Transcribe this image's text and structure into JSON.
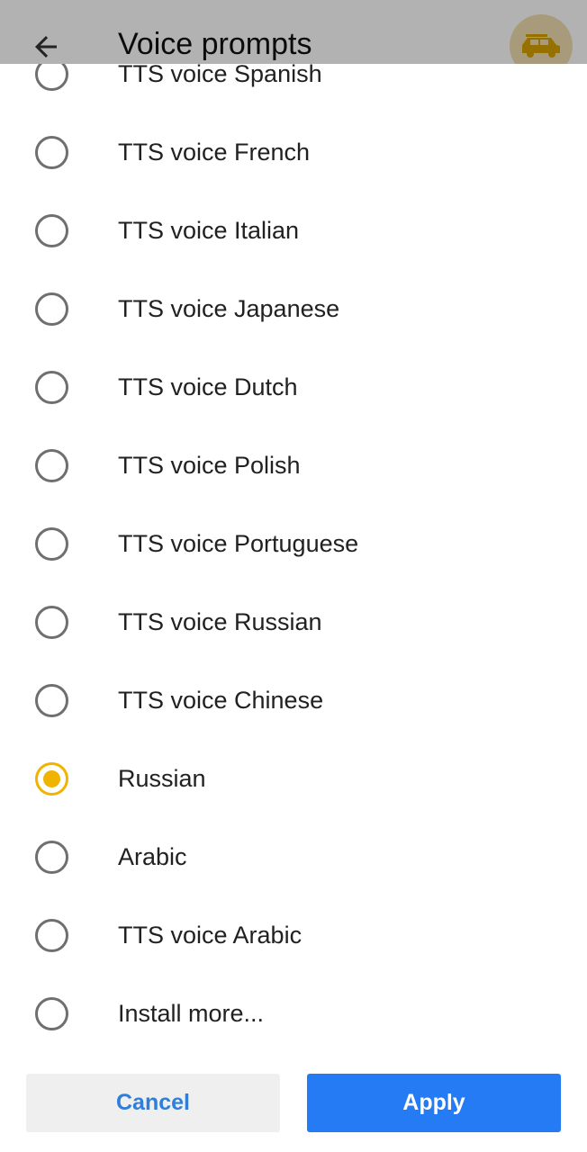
{
  "app_bar": {
    "title": "Voice prompts",
    "back_icon": "arrow-left-icon",
    "profile_icon": "car-icon",
    "profile_color": "#d9a200"
  },
  "colors": {
    "accent": "#f0b400",
    "primary_button": "#247bf4",
    "cancel_text": "#2f7ed8"
  },
  "options": [
    {
      "label": "TTS voice Spanish",
      "selected": false
    },
    {
      "label": "TTS voice French",
      "selected": false
    },
    {
      "label": "TTS voice Italian",
      "selected": false
    },
    {
      "label": "TTS voice Japanese",
      "selected": false
    },
    {
      "label": "TTS voice Dutch",
      "selected": false
    },
    {
      "label": "TTS voice Polish",
      "selected": false
    },
    {
      "label": "TTS voice Portuguese",
      "selected": false
    },
    {
      "label": "TTS voice Russian",
      "selected": false
    },
    {
      "label": "TTS voice Chinese",
      "selected": false
    },
    {
      "label": "Russian",
      "selected": true
    },
    {
      "label": "Arabic",
      "selected": false
    },
    {
      "label": "TTS voice Arabic",
      "selected": false
    },
    {
      "label": "Install more...",
      "selected": false
    }
  ],
  "buttons": {
    "cancel_label": "Cancel",
    "apply_label": "Apply"
  }
}
